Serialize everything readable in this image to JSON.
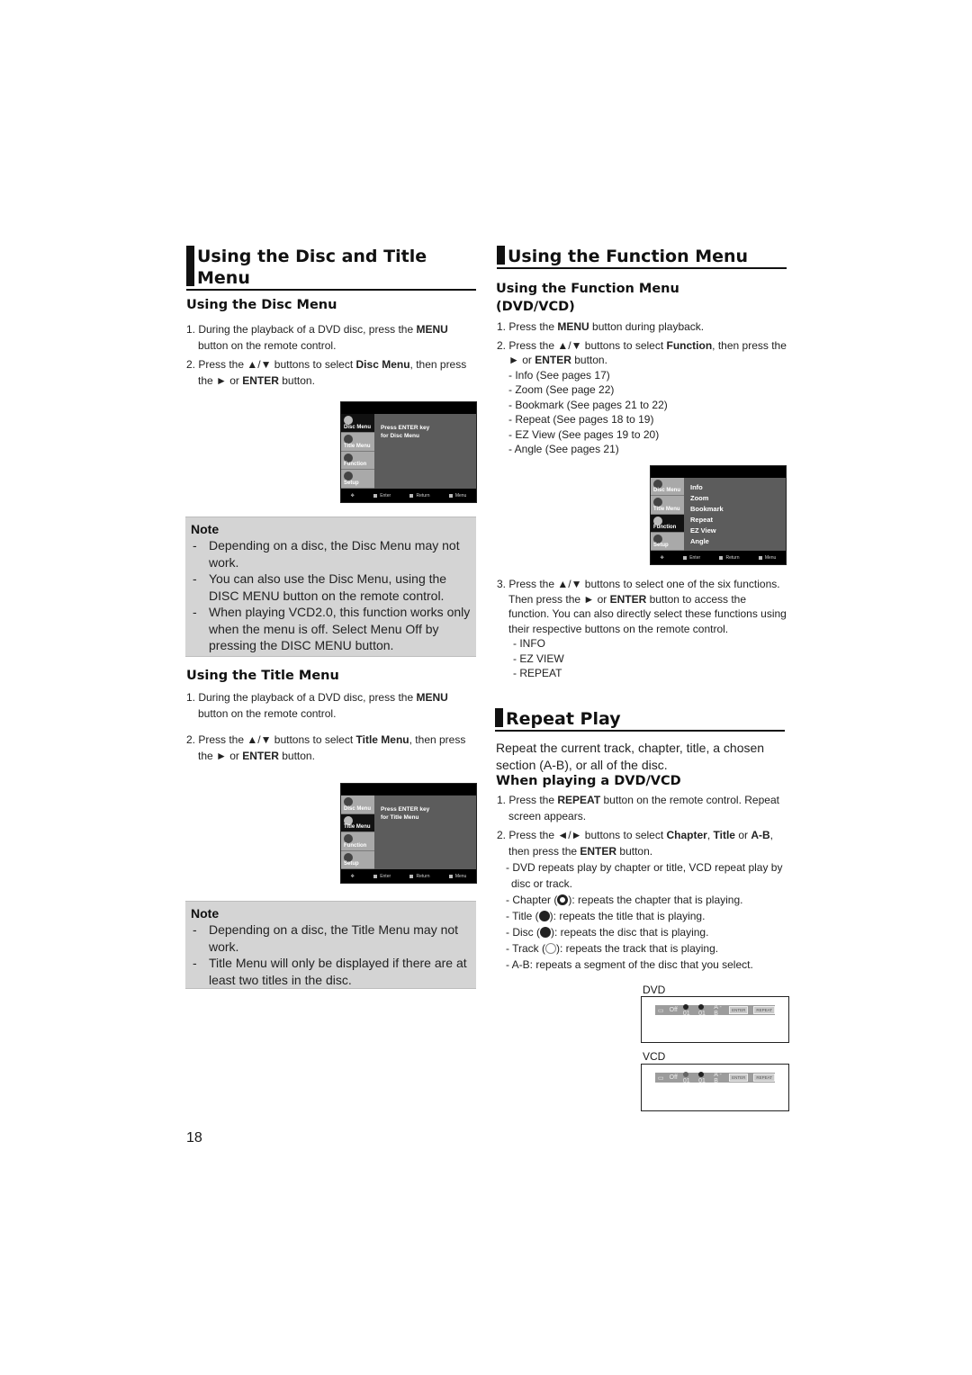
{
  "left": {
    "section_title_line1": "Using the Disc and Title",
    "section_title_line2": "Menu",
    "disc_menu": {
      "title": "Using the Disc Menu",
      "steps": [
        {
          "pre": "1. During the playback of a DVD disc, press the ",
          "bold": "MENU",
          "post": " button on the remote control."
        },
        {
          "pre": "2. Press the ▲/▼ buttons to select ",
          "bold": "Disc Menu",
          "post": ", then press the ► or ",
          "bold2": "ENTER",
          "post2": " button."
        }
      ],
      "osd": {
        "side": [
          "Disc Menu",
          "Title Menu",
          "Function",
          "Setup"
        ],
        "active": "Disc Menu",
        "line1": "Press ENTER key",
        "line2": "for Disc Menu",
        "footer": [
          "Enter",
          "Return",
          "Menu"
        ]
      },
      "note": {
        "heading": "Note",
        "items": [
          "Depending on a disc, the Disc Menu may not work.",
          "You can also use the Disc Menu, using the DISC MENU button on the remote control.",
          "When playing VCD2.0, this function works only when the menu is off. Select Menu Off by pressing the DISC MENU button."
        ]
      }
    },
    "title_menu": {
      "title": "Using the Title Menu",
      "steps": [
        {
          "pre": "1. During the playback of a DVD disc, press the ",
          "bold": "MENU",
          "post": " button on the remote control."
        },
        {
          "pre": "2. Press the ▲/▼ buttons to select ",
          "bold": "Title Menu",
          "post": ", then press the ► or ",
          "bold2": "ENTER",
          "post2": " button."
        }
      ],
      "osd": {
        "side": [
          "Disc Menu",
          "Title Menu",
          "Function",
          "Setup"
        ],
        "active": "Title Menu",
        "line1": "Press ENTER key",
        "line2": "for Title Menu",
        "footer": [
          "Enter",
          "Return",
          "Menu"
        ]
      },
      "note": {
        "heading": "Note",
        "items": [
          "Depending on a disc, the Title Menu may not work.",
          "Title Menu will only be displayed if there are at least two titles in the disc."
        ]
      }
    },
    "page_number": "18"
  },
  "right": {
    "section_title": "Using the Function Menu",
    "sub_title_line1": "Using the Function Menu",
    "sub_title_line2": "(DVD/VCD)",
    "steps": [
      {
        "pre": "1. Press the ",
        "bold": "MENU",
        "post": " button during playback."
      },
      {
        "pre": "2. Press the ▲/▼ buttons to select ",
        "bold": "Function",
        "post": ", then press the ► or ",
        "bold2": "ENTER",
        "post2": " button."
      }
    ],
    "functions_list": [
      "- Info (See pages 17)",
      "- Zoom (See page 22)",
      "- Bookmark (See pages 21 to 22)",
      "- Repeat (See pages 18 to 19)",
      "- EZ View (See pages 19 to 20)",
      "- Angle (See pages 21)"
    ],
    "osd": {
      "side": [
        "Disc Menu",
        "Title Menu",
        "Function",
        "Setup"
      ],
      "active": "Function",
      "items": [
        "Info",
        "Zoom",
        "Bookmark",
        "Repeat",
        "EZ View",
        "Angle"
      ],
      "footer": [
        "Enter",
        "Return",
        "Menu"
      ]
    },
    "step3": {
      "pre": "3. Press the ▲/▼ buttons to select one of the six functions. Then press the ► or ",
      "bold": "ENTER",
      "post": " button to access the function. You can also directly select these functions using their respective buttons on the remote control."
    },
    "direct_buttons": [
      "- INFO",
      "- EZ VIEW",
      "- REPEAT"
    ],
    "repeat": {
      "section_title": "Repeat Play",
      "intro": "Repeat the current track, chapter, title, a chosen section (A-B), or all of the disc.",
      "sub_title": "When playing a DVD/VCD",
      "step1": {
        "pre": "1. Press the ",
        "bold": "REPEAT",
        "post": " button on the remote control. Repeat screen appears."
      },
      "step2": {
        "pre": "2. Press the ◄/► buttons to select ",
        "b1": "Chapter",
        "m1": ", ",
        "b2": "Title",
        "m2": " or ",
        "b3": "A-B",
        "m3": ", then press the ",
        "b4": "ENTER",
        "post": " button."
      },
      "details": [
        "- DVD repeats play by chapter or title, VCD repeat play by disc or track."
      ],
      "modes": [
        {
          "pre": "- Chapter (",
          "icon": "chapter-repeat-icon",
          "post": "): repeats the chapter that is playing."
        },
        {
          "pre": "- Title (",
          "icon": "title-repeat-icon",
          "post": "): repeats the title that is playing."
        },
        {
          "pre": "- Disc (",
          "icon": "disc-repeat-icon",
          "post": "): repeats the disc that is playing."
        },
        {
          "pre": "- Track (",
          "icon": "track-repeat-icon",
          "post": "): repeats the track that is playing."
        }
      ],
      "ab_line": "- A-B: repeats a segment of the disc that you select.",
      "dvd_label": "DVD",
      "dvd_bar": {
        "off": "Off",
        "ch": "01",
        "ti": "01",
        "ab": "A - B",
        "enter": "ENTER",
        "repeat": "REPEAT"
      },
      "vcd_label": "VCD",
      "vcd_bar": {
        "off": "Off",
        "ch": "01",
        "ti": "01",
        "ab": "A - B",
        "enter": "ENTER",
        "repeat": "REPEAT"
      }
    }
  }
}
